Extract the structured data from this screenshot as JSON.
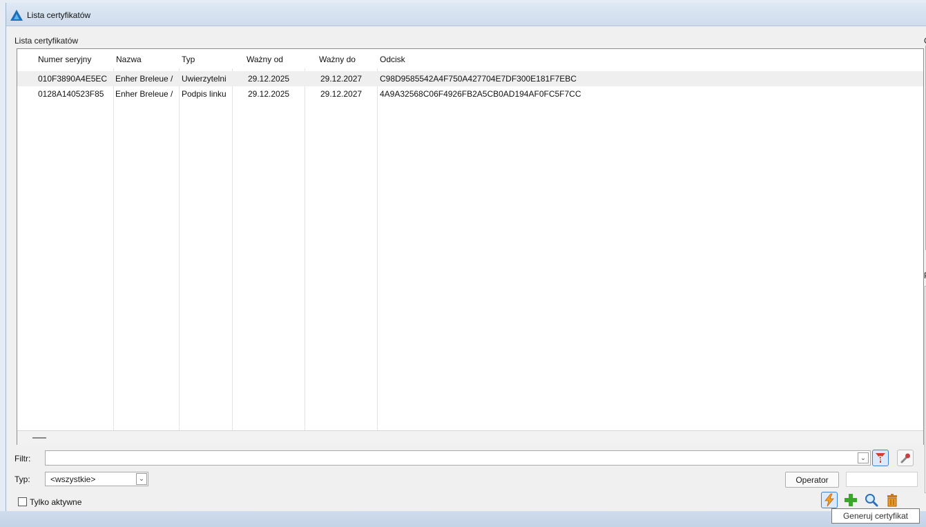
{
  "window": {
    "title": "Lista certyfikatów"
  },
  "group": {
    "label": "Lista certyfikatów",
    "cut_right_1": "C",
    "cut_right_2": "P"
  },
  "grid": {
    "headers": [
      "Numer seryjny",
      "Nazwa",
      "Typ",
      "Ważny od",
      "Ważny do",
      "Odcisk"
    ],
    "rows": [
      {
        "serial": "010F3890A4E5EC",
        "name": "Enher Breleue /",
        "type": "Uwierzytelni",
        "valid_from": "29.12.2025",
        "valid_to": "29.12.2027",
        "thumbprint": "C98D9585542A4F750A427704E7DF300E181F7EBC"
      },
      {
        "serial": "0128A140523F85",
        "name": "Enher Breleue /",
        "type": "Podpis linku",
        "valid_from": "29.12.2025",
        "valid_to": "29.12.2027",
        "thumbprint": "4A9A32568C06F4926FB2A5CB0AD194AF0FC5F7CC"
      }
    ]
  },
  "filter": {
    "label": "Filtr:",
    "value": ""
  },
  "typ": {
    "label": "Typ:",
    "selected": "<wszystkie>"
  },
  "operator": {
    "label": "Operator",
    "value": ""
  },
  "active_only": {
    "label": "Tylko aktywne",
    "checked": false
  },
  "tooltip": {
    "text": "Generuj certyfikat"
  },
  "icons": {
    "app": "logo-icon",
    "filter_help": "filter-question-icon",
    "filter_settings": "filter-wrench-icon",
    "generate": "lightning-icon",
    "add": "plus-icon",
    "view": "magnifier-icon",
    "delete": "trash-icon"
  },
  "colors": {
    "accent": "#3c7fd6",
    "add_green": "#3aa62a",
    "delete_orange": "#c77a16",
    "generate_orange": "#e8a020"
  }
}
